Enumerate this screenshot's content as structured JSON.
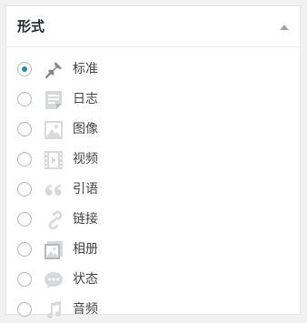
{
  "panel": {
    "title": "形式"
  },
  "formats": [
    {
      "label": "标准",
      "icon": "pin-icon",
      "checked": true
    },
    {
      "label": "日志",
      "icon": "aside-icon",
      "checked": false
    },
    {
      "label": "图像",
      "icon": "image-icon",
      "checked": false
    },
    {
      "label": "视频",
      "icon": "video-icon",
      "checked": false
    },
    {
      "label": "引语",
      "icon": "quote-icon",
      "checked": false
    },
    {
      "label": "链接",
      "icon": "link-icon",
      "checked": false
    },
    {
      "label": "相册",
      "icon": "gallery-icon",
      "checked": false
    },
    {
      "label": "状态",
      "icon": "status-icon",
      "checked": false
    },
    {
      "label": "音频",
      "icon": "audio-icon",
      "checked": false
    }
  ],
  "colors": {
    "accent": "#1e8cbe",
    "icon_gray": "#a0a5aa",
    "pin_gray": "#82878c"
  }
}
